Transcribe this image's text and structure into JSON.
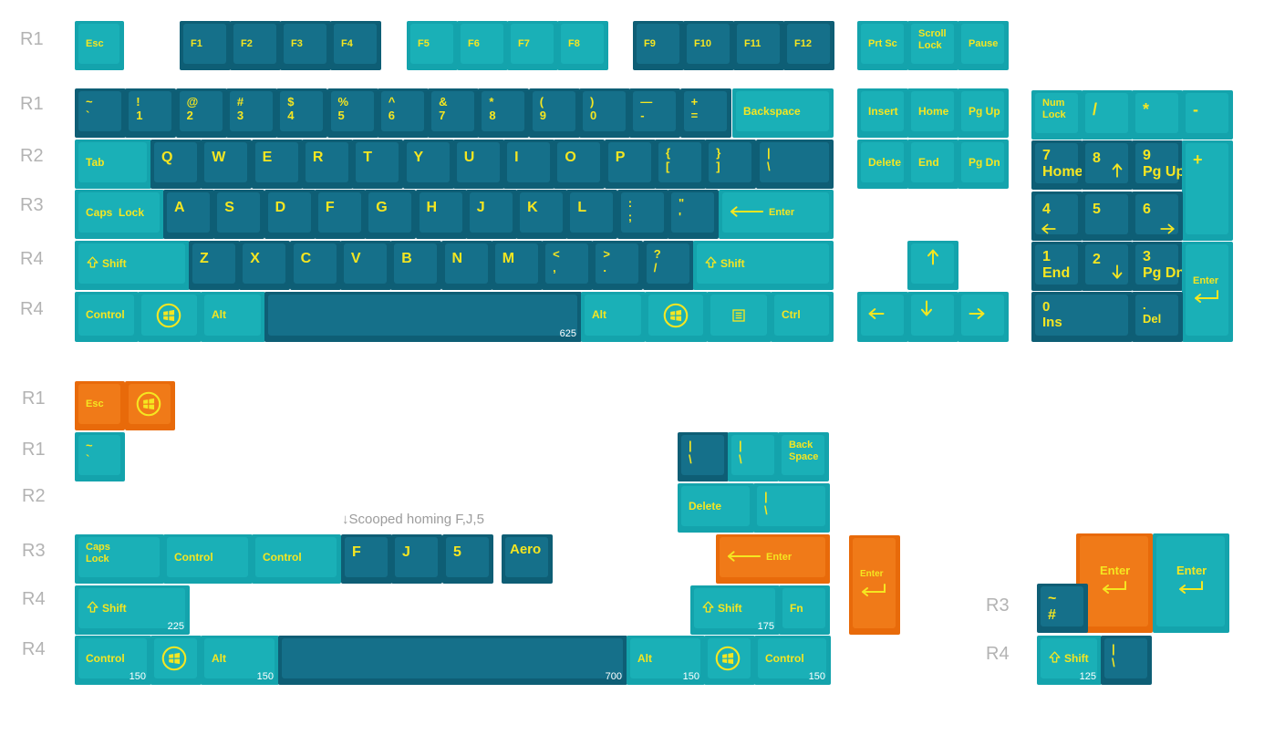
{
  "row_labels": [
    "R1",
    "R1",
    "R2",
    "R3",
    "R4",
    "R4",
    "R1",
    "R1",
    "R2",
    "R3",
    "R4",
    "R4",
    "R3",
    "R4"
  ],
  "colors": {
    "teal": "#14a3ac",
    "teal_cap": "#1ab0b7",
    "dark": "#0e5e75",
    "dark_cap": "#15708a",
    "orange": "#e86a0a",
    "orange_cap": "#f07a18",
    "legend": "#f5e621"
  },
  "note": "↓Scooped homing F,J,5",
  "keys": [
    {
      "l": "Esc",
      "c": "t"
    },
    {
      "l": "F1",
      "c": "d"
    },
    {
      "l": "F2",
      "c": "d"
    },
    {
      "l": "F3",
      "c": "d"
    },
    {
      "l": "F4",
      "c": "d"
    },
    {
      "l": "F5",
      "c": "t"
    },
    {
      "l": "F6",
      "c": "t"
    },
    {
      "l": "F7",
      "c": "t"
    },
    {
      "l": "F8",
      "c": "t"
    },
    {
      "l": "F9",
      "c": "d"
    },
    {
      "l": "F10",
      "c": "d"
    },
    {
      "l": "F11",
      "c": "d"
    },
    {
      "l": "F12",
      "c": "d"
    },
    {
      "l": "Prt Sc",
      "c": "t"
    },
    {
      "l": "Scroll\nLock",
      "c": "t"
    },
    {
      "l": "Pause",
      "c": "t"
    },
    {
      "l": "~\n`",
      "c": "d"
    },
    {
      "l": "!\n1",
      "c": "d"
    },
    {
      "l": "@\n2",
      "c": "d"
    },
    {
      "l": "#\n3",
      "c": "d"
    },
    {
      "l": "$\n4",
      "c": "d"
    },
    {
      "l": "%\n5",
      "c": "d"
    },
    {
      "l": "^\n6",
      "c": "d"
    },
    {
      "l": "&\n7",
      "c": "d"
    },
    {
      "l": "*\n8",
      "c": "d"
    },
    {
      "l": "(\n9",
      "c": "d"
    },
    {
      "l": ")\n0",
      "c": "d"
    },
    {
      "l": "—\n-",
      "c": "d"
    },
    {
      "l": "+\n=",
      "c": "d"
    },
    {
      "l": "Backspace",
      "c": "t"
    },
    {
      "l": "Insert",
      "c": "t"
    },
    {
      "l": "Home",
      "c": "t"
    },
    {
      "l": "Pg Up",
      "c": "t"
    },
    {
      "l": "Num\nLock",
      "c": "t"
    },
    {
      "l": "/",
      "c": "t"
    },
    {
      "l": "*",
      "c": "t"
    },
    {
      "l": "-",
      "c": "t"
    },
    {
      "l": "Tab",
      "c": "t"
    },
    {
      "l": "Q",
      "c": "d"
    },
    {
      "l": "W",
      "c": "d"
    },
    {
      "l": "E",
      "c": "d"
    },
    {
      "l": "R",
      "c": "d"
    },
    {
      "l": "T",
      "c": "d"
    },
    {
      "l": "Y",
      "c": "d"
    },
    {
      "l": "U",
      "c": "d"
    },
    {
      "l": "I",
      "c": "d"
    },
    {
      "l": "O",
      "c": "d"
    },
    {
      "l": "P",
      "c": "d"
    },
    {
      "l": "{\n[",
      "c": "d"
    },
    {
      "l": "}\n]",
      "c": "d"
    },
    {
      "l": "|\n\\",
      "c": "d"
    },
    {
      "l": "Delete",
      "c": "t"
    },
    {
      "l": "End",
      "c": "t"
    },
    {
      "l": "Pg Dn",
      "c": "t"
    },
    {
      "l": "7\nHome",
      "c": "d"
    },
    {
      "l": "8",
      "c": "d"
    },
    {
      "l": "9\nPg Up",
      "c": "d"
    },
    {
      "l": "+",
      "c": "t"
    },
    {
      "l": "Caps  Lock",
      "c": "t"
    },
    {
      "l": "A",
      "c": "d"
    },
    {
      "l": "S",
      "c": "d"
    },
    {
      "l": "D",
      "c": "d"
    },
    {
      "l": "F",
      "c": "d"
    },
    {
      "l": "G",
      "c": "d"
    },
    {
      "l": "H",
      "c": "d"
    },
    {
      "l": "J",
      "c": "d"
    },
    {
      "l": "K",
      "c": "d"
    },
    {
      "l": "L",
      "c": "d"
    },
    {
      "l": ":\n;",
      "c": "d"
    },
    {
      "l": "\"\n'",
      "c": "d"
    },
    {
      "l": "Enter",
      "c": "t"
    },
    {
      "l": "4",
      "c": "d"
    },
    {
      "l": "5",
      "c": "d"
    },
    {
      "l": "6",
      "c": "d"
    },
    {
      "l": "Shift",
      "c": "t"
    },
    {
      "l": "Z",
      "c": "d"
    },
    {
      "l": "X",
      "c": "d"
    },
    {
      "l": "C",
      "c": "d"
    },
    {
      "l": "V",
      "c": "d"
    },
    {
      "l": "B",
      "c": "d"
    },
    {
      "l": "N",
      "c": "d"
    },
    {
      "l": "M",
      "c": "d"
    },
    {
      "l": "<\n,",
      "c": "d"
    },
    {
      "l": ">\n.",
      "c": "d"
    },
    {
      "l": "?\n/",
      "c": "d"
    },
    {
      "l": "Shift",
      "c": "t"
    },
    {
      "l": "",
      "c": "t"
    },
    {
      "l": "1\nEnd",
      "c": "d"
    },
    {
      "l": "2",
      "c": "d"
    },
    {
      "l": "3\nPg Dn",
      "c": "d"
    },
    {
      "l": "Enter",
      "c": "t"
    },
    {
      "l": "Control",
      "c": "t"
    },
    {
      "l": "",
      "c": "t"
    },
    {
      "l": "Alt",
      "c": "t"
    },
    {
      "l": "",
      "c": "d",
      "s": "625"
    },
    {
      "l": "Alt",
      "c": "t"
    },
    {
      "l": "",
      "c": "t"
    },
    {
      "l": "",
      "c": "t"
    },
    {
      "l": "Ctrl",
      "c": "t"
    },
    {
      "l": "",
      "c": "t"
    },
    {
      "l": "",
      "c": "t"
    },
    {
      "l": "",
      "c": "t"
    },
    {
      "l": "0\nIns",
      "c": "d"
    },
    {
      "l": ".\nDel",
      "c": "d"
    },
    {
      "l": "Esc",
      "c": "o"
    },
    {
      "l": "",
      "c": "o"
    },
    {
      "l": "~\n`",
      "c": "t"
    },
    {
      "l": "|\n\\",
      "c": "d"
    },
    {
      "l": "|\n\\",
      "c": "t"
    },
    {
      "l": "Back\nSpace",
      "c": "t"
    },
    {
      "l": "Delete",
      "c": "t"
    },
    {
      "l": "|\n\\",
      "c": "t"
    },
    {
      "l": "Caps\nLock",
      "c": "t"
    },
    {
      "l": "Control",
      "c": "t"
    },
    {
      "l": "Control",
      "c": "t"
    },
    {
      "l": "F",
      "c": "d"
    },
    {
      "l": "J",
      "c": "d"
    },
    {
      "l": "5",
      "c": "d"
    },
    {
      "l": "Aero",
      "c": "d"
    },
    {
      "l": "Enter",
      "c": "o"
    },
    {
      "l": "Enter",
      "c": "o"
    },
    {
      "l": "Enter",
      "c": "o"
    },
    {
      "l": "Enter",
      "c": "t"
    },
    {
      "l": "Shift",
      "c": "t",
      "s": "225"
    },
    {
      "l": "Shift",
      "c": "t",
      "s": "175"
    },
    {
      "l": "Fn",
      "c": "t"
    },
    {
      "l": "~\n#",
      "c": "d"
    },
    {
      "l": "Control",
      "c": "t",
      "s": "150"
    },
    {
      "l": "",
      "c": "t"
    },
    {
      "l": "Alt",
      "c": "t",
      "s": "150"
    },
    {
      "l": "",
      "c": "d",
      "s": "700"
    },
    {
      "l": "Alt",
      "c": "t",
      "s": "150"
    },
    {
      "l": "",
      "c": "t"
    },
    {
      "l": "Control",
      "c": "t",
      "s": "150"
    },
    {
      "l": "Shift",
      "c": "t",
      "s": "125"
    },
    {
      "l": "|\n\\",
      "c": "d"
    }
  ]
}
